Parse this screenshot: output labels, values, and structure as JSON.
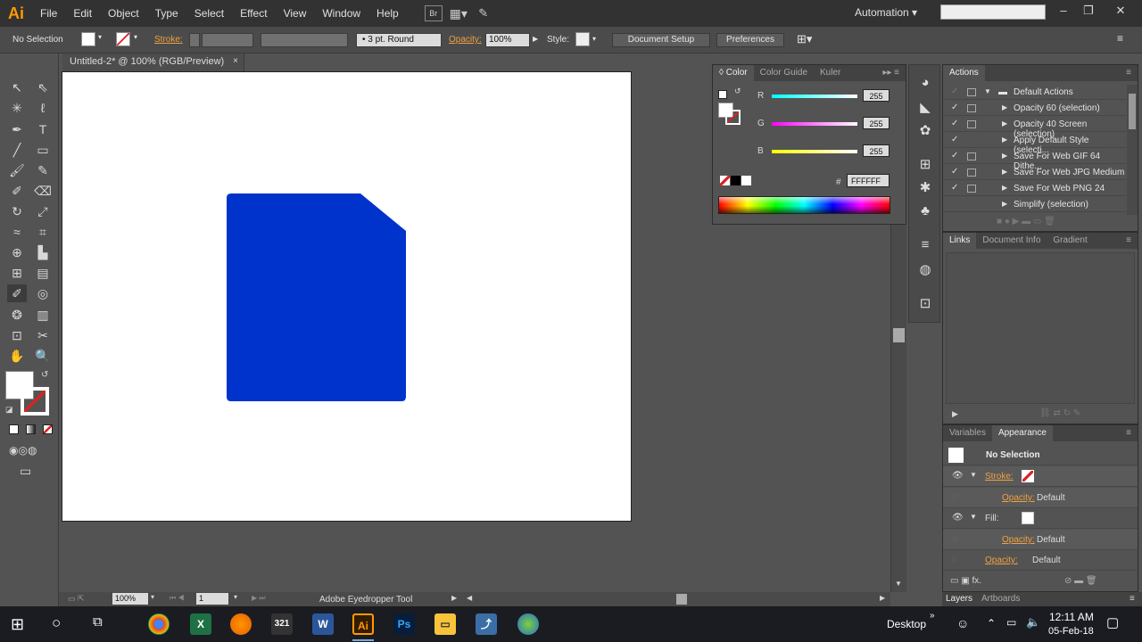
{
  "menubar": {
    "logo": "Ai",
    "items": [
      "File",
      "Edit",
      "Object",
      "Type",
      "Select",
      "Effect",
      "View",
      "Window",
      "Help"
    ],
    "bridge_label": "Br",
    "workspace": "Automation",
    "search_placeholder": ""
  },
  "controlbar": {
    "selection_status": "No Selection",
    "stroke_label": "Stroke:",
    "brush_value": "3 pt. Round",
    "opacity_label": "Opacity:",
    "opacity_value": "100%",
    "style_label": "Style:",
    "document_setup": "Document Setup",
    "preferences": "Preferences"
  },
  "document": {
    "tab_title": "Untitled-2* @ 100% (RGB/Preview)",
    "shape_color": "#0033cc"
  },
  "status": {
    "zoom": "100%",
    "artboard_number": "1",
    "tool_name": "Adobe Eyedropper Tool"
  },
  "color_panel": {
    "tabs": [
      "Color",
      "Color Guide",
      "Kuler"
    ],
    "r_label": "R",
    "g_label": "G",
    "b_label": "B",
    "r_value": "255",
    "g_value": "255",
    "b_value": "255",
    "hex_label": "#",
    "hex_value": "FFFFFF"
  },
  "actions_panel": {
    "title": "Actions",
    "rows": [
      {
        "label": "Default Actions",
        "folder": true
      },
      {
        "label": "Opacity 60 (selection)"
      },
      {
        "label": "Opacity 40 Screen (selection)"
      },
      {
        "label": "Apply Default Style (selecti..."
      },
      {
        "label": "Save For Web GIF 64 Dithe..."
      },
      {
        "label": "Save For Web JPG Medium"
      },
      {
        "label": "Save For Web PNG 24"
      },
      {
        "label": "Simplify (selection)"
      }
    ]
  },
  "links_panel": {
    "tabs": [
      "Links",
      "Document Info",
      "Gradient"
    ]
  },
  "appearance_panel": {
    "tabs": [
      "Variables",
      "Appearance"
    ],
    "title": "No Selection",
    "stroke_label": "Stroke:",
    "fill_label": "Fill:",
    "opacity_label": "Opacity:",
    "opacity_value": "Default"
  },
  "bottom_tabs": [
    "Layers",
    "Artboards"
  ],
  "taskbar": {
    "desktop_label": "Desktop",
    "time": "12:11 AM",
    "date": "05-Feb-18"
  }
}
